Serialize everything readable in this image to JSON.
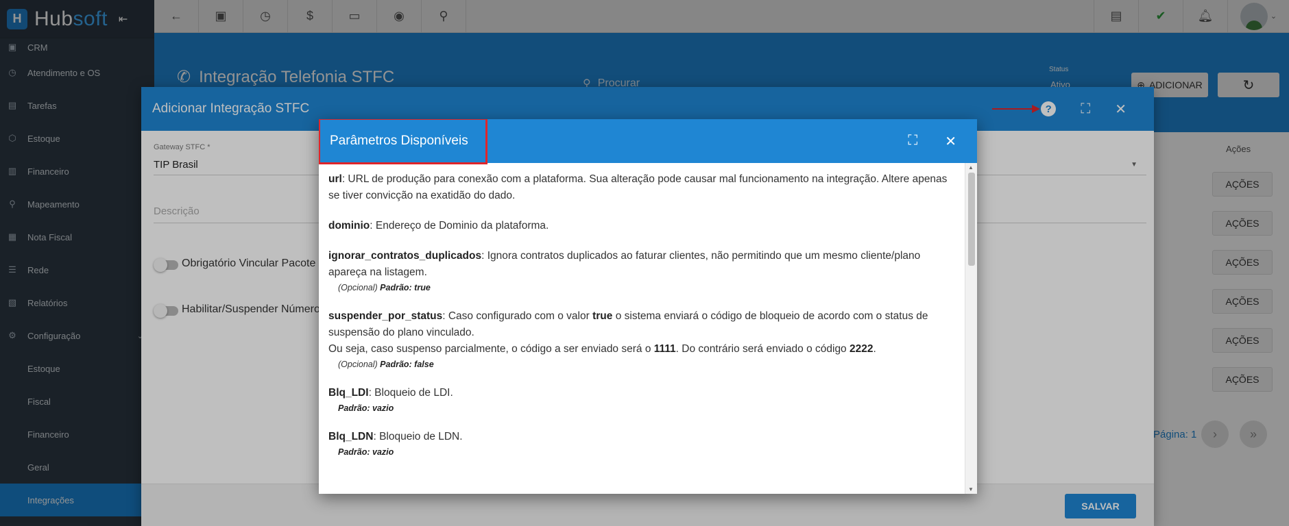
{
  "brand": {
    "name_part1": "Hub",
    "name_part2": "soft"
  },
  "sidebar": {
    "items": [
      {
        "label": "CRM",
        "icon": "board-icon"
      },
      {
        "label": "Atendimento e OS",
        "icon": "calendar-clock-icon"
      },
      {
        "label": "Tarefas",
        "icon": "briefcase-icon"
      },
      {
        "label": "Estoque",
        "icon": "box-icon"
      },
      {
        "label": "Financeiro",
        "icon": "money-icon"
      },
      {
        "label": "Mapeamento",
        "icon": "map-pin-icon"
      },
      {
        "label": "Nota Fiscal",
        "icon": "receipt-icon"
      },
      {
        "label": "Rede",
        "icon": "server-icon"
      },
      {
        "label": "Relatórios",
        "icon": "report-icon"
      },
      {
        "label": "Configuração",
        "icon": "gear-icon"
      }
    ],
    "subitems": [
      "Estoque",
      "Fiscal",
      "Financeiro",
      "Geral",
      "Integrações"
    ]
  },
  "page": {
    "title": "Integração Telefonia STFC",
    "search_placeholder": "Procurar",
    "status_label": "Status",
    "status_value": "Ativo",
    "add_label": "ADICIONAR"
  },
  "table": {
    "actions_header": "Ações",
    "action_button": "AÇÕES",
    "pagination_label": "Página: 1"
  },
  "modal": {
    "title": "Adicionar Integração STFC",
    "gateway_label": "Gateway STFC *",
    "gateway_value": "TIP Brasil",
    "description_placeholder": "Descrição",
    "toggle1_label": "Obrigatório Vincular Pacote",
    "toggle2_label": "Habilitar/Suspender Número",
    "save_label": "SALVAR"
  },
  "inner": {
    "title": "Parâmetros Disponíveis",
    "params": {
      "url_name": "url",
      "url_desc": ": URL de produção para conexão com a plataforma. Sua alteração pode causar mal funcionamento na integração. Altere apenas se tiver convicção na exatidão do dado.",
      "dominio_name": "dominio",
      "dominio_desc": ": Endereço de Dominio da plataforma.",
      "ignorar_name": "ignorar_contratos_duplicados",
      "ignorar_desc": ": Ignora contratos duplicados ao faturar clientes, não permitindo que um mesmo cliente/plano apareça na listagem.",
      "ignorar_opt": "(Opcional)",
      "ignorar_default": "Padrão: true",
      "susp_name": "suspender_por_status",
      "susp_desc1": ": Caso configurado com o valor ",
      "susp_true": "true",
      "susp_desc2": " o sistema enviará o código de bloqueio de acordo com o status de suspensão do plano vinculado.",
      "susp_line2a": "Ou seja, caso suspenso parcialmente, o código a ser enviado será o ",
      "susp_code1": "1111",
      "susp_line2b": ". Do contrário será enviado o código ",
      "susp_code2": "2222",
      "susp_line2c": ".",
      "susp_opt": "(Opcional)",
      "susp_default": "Padrão: false",
      "ldi_name": "Blq_LDI",
      "ldi_desc": ": Bloqueio de LDI.",
      "ldi_default": "Padrão: vazio",
      "ldn_name": "Blq_LDN",
      "ldn_desc": ": Bloqueio de LDN.",
      "ldn_default": "Padrão: vazio"
    }
  },
  "colors": {
    "primary": "#1f86d3",
    "sidebar": "#2e3a46",
    "highlight": "#e0252a"
  }
}
